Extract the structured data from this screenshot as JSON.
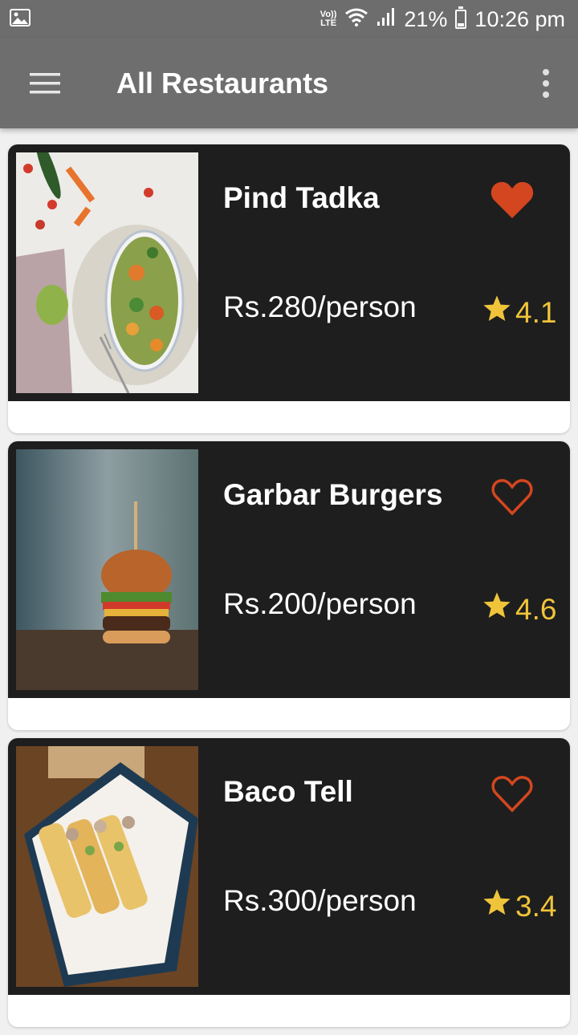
{
  "status_bar": {
    "volte_top": "Vo))",
    "volte_bottom": "LTE",
    "battery": "21%",
    "time": "10:26 pm"
  },
  "app_bar": {
    "title": "All Restaurants",
    "menu_icon": "hamburger-menu-icon",
    "more_icon": "more-vertical-icon"
  },
  "colors": {
    "app_bar": "#6e6e6e",
    "card_bg": "#1e1e1e",
    "heart": "#d4461f",
    "star": "#f0c43a"
  },
  "restaurants": [
    {
      "name": "Pind Tadka",
      "price": "Rs.280/person",
      "rating": "4.1",
      "favorite": true,
      "image": "salad-bowl-photo"
    },
    {
      "name": "Garbar Burgers",
      "price": "Rs.200/person",
      "rating": "4.6",
      "favorite": false,
      "image": "burger-photo"
    },
    {
      "name": "Baco Tell",
      "price": "Rs.300/person",
      "rating": "3.4",
      "favorite": false,
      "image": "tacos-photo"
    }
  ]
}
